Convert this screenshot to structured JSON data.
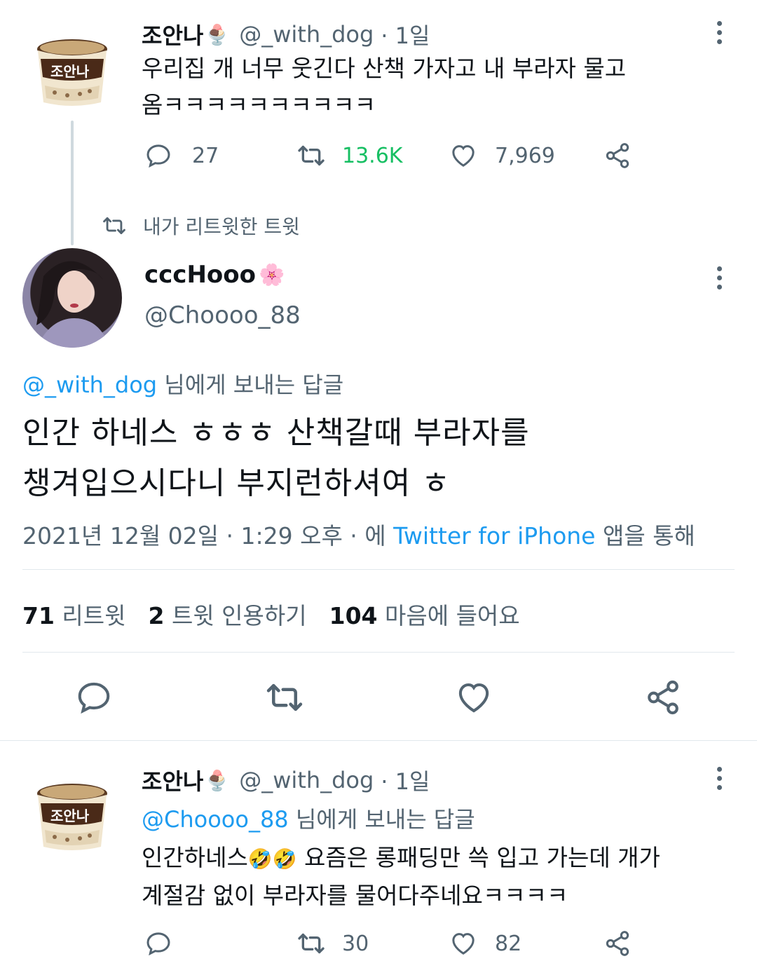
{
  "tweet1": {
    "name": "조안나",
    "handle": "@_with_dog",
    "time": "· 1일",
    "text_line1": "우리집 개 너무 웃긴다 산책 가자고 내 부라자 물고",
    "text_line2": "옴ㅋㅋㅋㅋㅋㅋㅋㅋㅋㅋ",
    "replies": "27",
    "retweets": "13.6K",
    "likes": "7,969",
    "avatar_text": "조안나"
  },
  "retweet_label": "내가 리트윗한 트윗",
  "tweet2": {
    "name": "cccHooo",
    "handle": "@Choooo_88",
    "reply_to_handle": "@_with_dog",
    "reply_to_suffix": " 님에게 보내는 답글",
    "text_line1": "인간 하네스 ㅎㅎㅎ 산책갈때 부라자를",
    "text_line2": "챙겨입으시다니 부지런하셔여 ㅎ",
    "date": "2021년 12월 02일 · 1:29 오후 · 에 ",
    "source": "Twitter for iPhone",
    "source_suffix": " 앱을 통해",
    "retweets_num": "71",
    "retweets_label": " 리트윗",
    "quotes_num": "2",
    "quotes_label": " 트윗 인용하기",
    "likes_num": "104",
    "likes_label": " 마음에 들어요"
  },
  "tweet3": {
    "name": "조안나",
    "handle": "@_with_dog",
    "time": "· 1일",
    "reply_to_handle": "@Choooo_88",
    "reply_to_suffix": " 님에게 보내는 답글",
    "text_line1a": "인간하네스",
    "text_line1b": " 요즘은 롱패딩만 쓱 입고 가는데 개가",
    "text_line2": "계절감 없이 부라자를 물어다주네요ㅋㅋㅋㅋ",
    "replies": "",
    "retweets": "30",
    "likes": "82",
    "avatar_text": "조안나"
  },
  "colors": {
    "accent_blue": "#1d9bf0",
    "retweet_green": "#17bf63",
    "text_gray": "#536471"
  },
  "icons": [
    "ice-cream-emoji",
    "cherry-blossom-emoji",
    "laughing-emoji",
    "reply-icon",
    "retweet-icon",
    "like-icon",
    "share-icon",
    "more-icon"
  ]
}
